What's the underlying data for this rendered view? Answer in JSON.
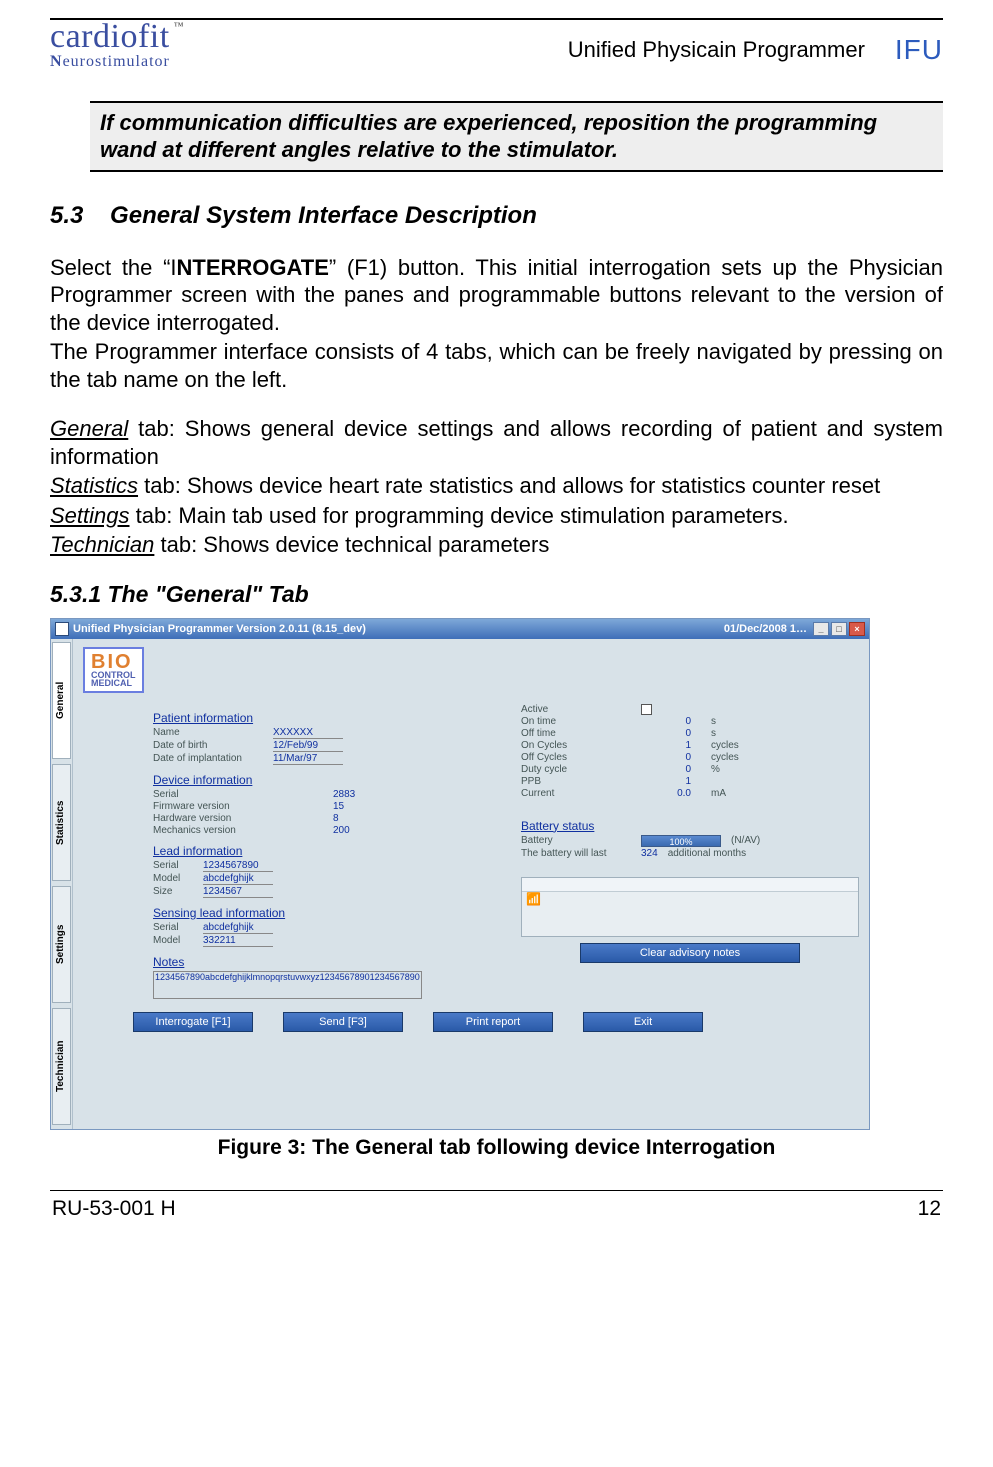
{
  "header": {
    "logo_main": "cardiofit",
    "logo_tm": "™",
    "logo_sub": "Neurostimulator",
    "doc_title": "Unified Physicain Programmer",
    "ifu": "IFU"
  },
  "note": "If communication difficulties are experienced, reposition the programming wand at different angles relative to the stimulator.",
  "section_num": "5.3",
  "section_title": "General System Interface Description",
  "para1a": "Select the “I",
  "para1b": "NTERROGATE",
  "para1c": "” (F1) button. This initial interrogation sets up the Physician Programmer screen with the panes and programmable buttons relevant to the version of the device interrogated.",
  "para2": "The Programmer interface consists of 4 tabs, which can be freely navigated by pressing on the tab name on the left.",
  "tabs_desc": {
    "general_name": "General",
    "general_rest": " tab: Shows general device settings and allows recording of patient and system information",
    "stats_name": "Statistics",
    "stats_rest": " tab: Shows device heart rate statistics and allows for statistics counter reset",
    "settings_name": "Settings",
    "settings_rest": " tab: Main tab used for programming device stimulation parameters.",
    "tech_name": "Technician",
    "tech_rest": " tab: Shows device technical parameters"
  },
  "subsection": "5.3.1 The \"General\" Tab",
  "app": {
    "title_left": "Unified Physician Programmer Version    2.0.11    (8.15_dev)",
    "title_right": "01/Dec/2008 1…",
    "side_tabs": [
      "General",
      "Statistics",
      "Settings",
      "Technician"
    ],
    "bio": {
      "l1": "BIO",
      "l2": "CONTROL",
      "l3": "MEDICAL"
    },
    "patient": {
      "head": "Patient information",
      "name_lbl": "Name",
      "name_val": "XXXXXX",
      "dob_lbl": "Date of birth",
      "dob_val": "12/Feb/99",
      "doi_lbl": "Date of implantation",
      "doi_val": "11/Mar/97"
    },
    "device": {
      "head": "Device information",
      "serial_lbl": "Serial",
      "serial_val": "2883",
      "fw_lbl": "Firmware version",
      "fw_val": "15",
      "hw_lbl": "Hardware version",
      "hw_val": "8",
      "mech_lbl": "Mechanics version",
      "mech_val": "200"
    },
    "lead": {
      "head": "Lead information",
      "serial_lbl": "Serial",
      "serial_val": "1234567890",
      "model_lbl": "Model",
      "model_val": "abcdefghijk",
      "size_lbl": "Size",
      "size_val": "1234567"
    },
    "sensing": {
      "head": "Sensing lead information",
      "serial_lbl": "Serial",
      "serial_val": "abcdefghijk",
      "model_lbl": "Model",
      "model_val": "332211"
    },
    "notes": {
      "head": "Notes",
      "val": "1234567890abcdefghijklmnopqrstuvwxyz12345678901234567890"
    },
    "status": {
      "active_lbl": "Active",
      "on_lbl": "On time",
      "on_val": "0",
      "on_unit": "s",
      "off_lbl": "Off time",
      "off_val": "0",
      "off_unit": "s",
      "onc_lbl": "On Cycles",
      "onc_val": "1",
      "onc_unit": "cycles",
      "offc_lbl": "Off Cycles",
      "offc_val": "0",
      "offc_unit": "cycles",
      "duty_lbl": "Duty cycle",
      "duty_val": "0",
      "duty_unit": "%",
      "ppb_lbl": "PPB",
      "ppb_val": "1",
      "ppb_unit": "",
      "cur_lbl": "Current",
      "cur_val": "0.0",
      "cur_unit": "mA"
    },
    "battery": {
      "head": "Battery status",
      "bat_lbl": "Battery",
      "bat_val": "100%",
      "bat_note": "(N/AV)",
      "last_lbl": "The battery will last",
      "last_val": "324",
      "last_unit": "additional months"
    },
    "clear_btn": "Clear advisory notes",
    "buttons": {
      "interrogate": "Interrogate  [F1]",
      "send": "Send  [F3]",
      "print": "Print report",
      "exit": "Exit"
    }
  },
  "figure_caption": "Figure 3: The General tab following device Interrogation",
  "footer": {
    "left": "RU-53-001 H",
    "right": "12"
  }
}
